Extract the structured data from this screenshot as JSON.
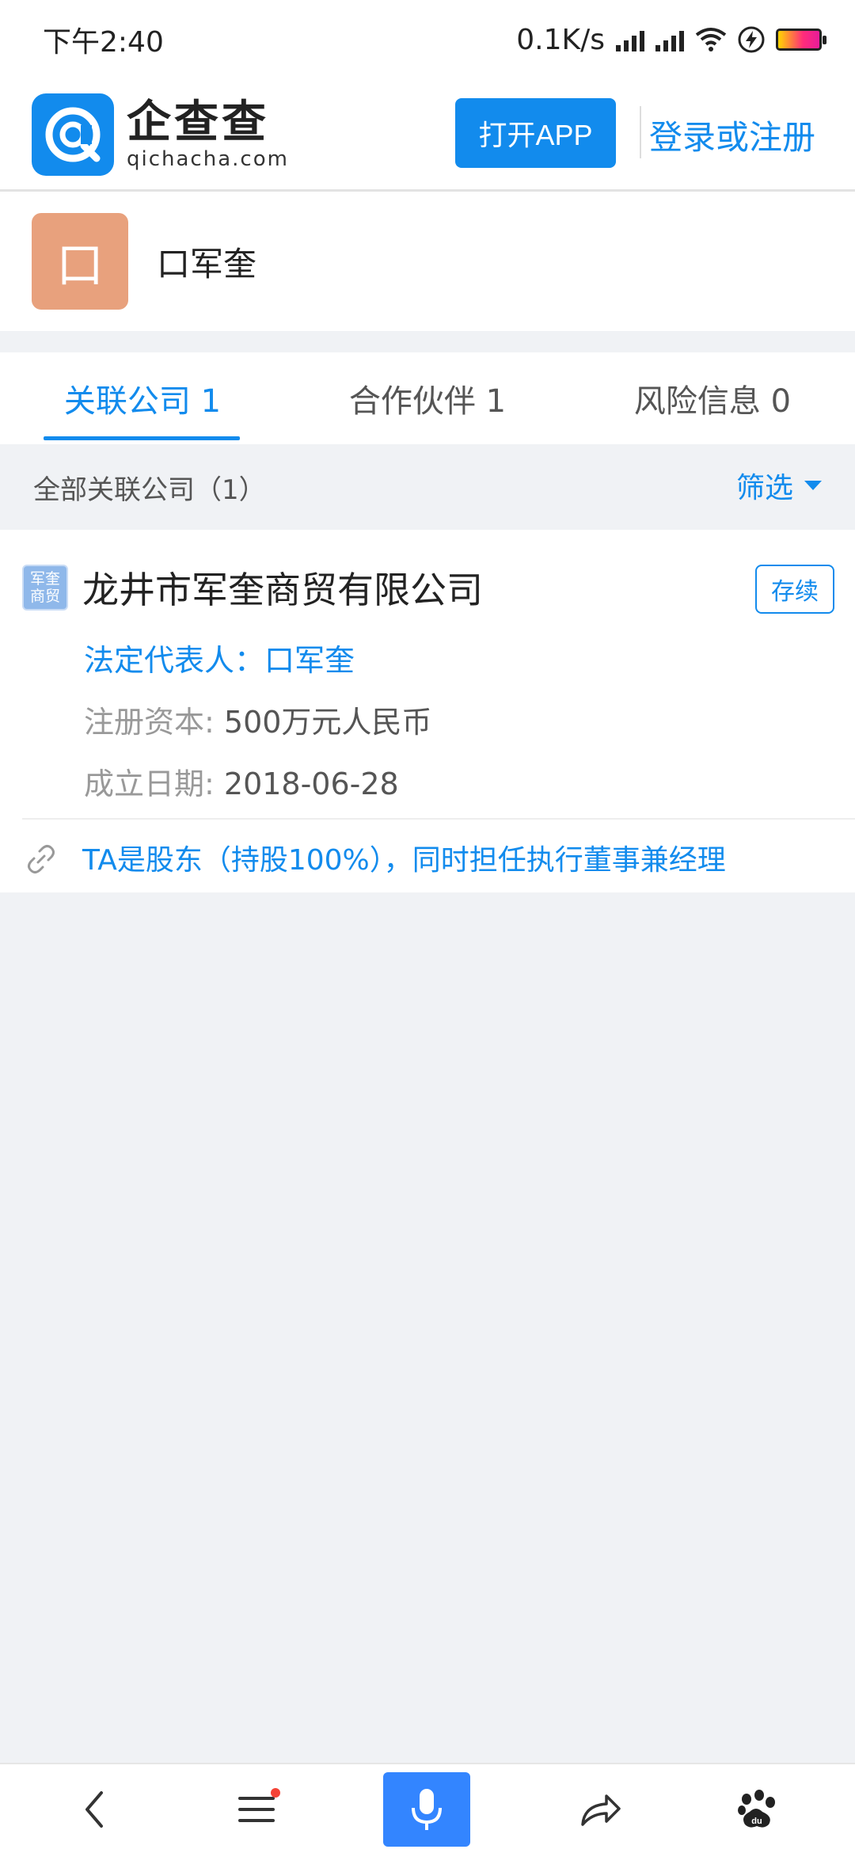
{
  "status_bar": {
    "time": "下午2:40",
    "net_speed": "0.1K/s"
  },
  "header": {
    "logo_cn": "企查查",
    "logo_en": "qichacha.com",
    "open_app_label": "打开APP",
    "login_label": "登录或注册"
  },
  "person": {
    "avatar_char": "口",
    "name": "口军奎"
  },
  "tabs": [
    {
      "label": "关联公司 1",
      "active": true
    },
    {
      "label": "合作伙伴 1",
      "active": false
    },
    {
      "label": "风险信息 0",
      "active": false
    }
  ],
  "filter_bar": {
    "summary": "全部关联公司（1）",
    "filter_label": "筛选"
  },
  "company": {
    "icon_line1": "军奎",
    "icon_line2": "商贸",
    "name": "龙井市军奎商贸有限公司",
    "status": "存续",
    "legal_rep": "法定代表人：口军奎",
    "capital_key": "注册资本:",
    "capital_value": " 500万元人民币",
    "date_key": "成立日期:",
    "date_value": " 2018-06-28",
    "relation": "TA是股东（持股100%），同时担任执行董事兼经理"
  },
  "colors": {
    "accent": "#128bed",
    "avatar_bg": "#e8a17d",
    "mic_bg": "#3385ff"
  },
  "icons": [
    "back-icon",
    "menu-icon",
    "mic-icon",
    "share-icon",
    "baidu-paw-icon",
    "link-icon",
    "wifi-icon",
    "lightning-icon",
    "battery-icon"
  ]
}
